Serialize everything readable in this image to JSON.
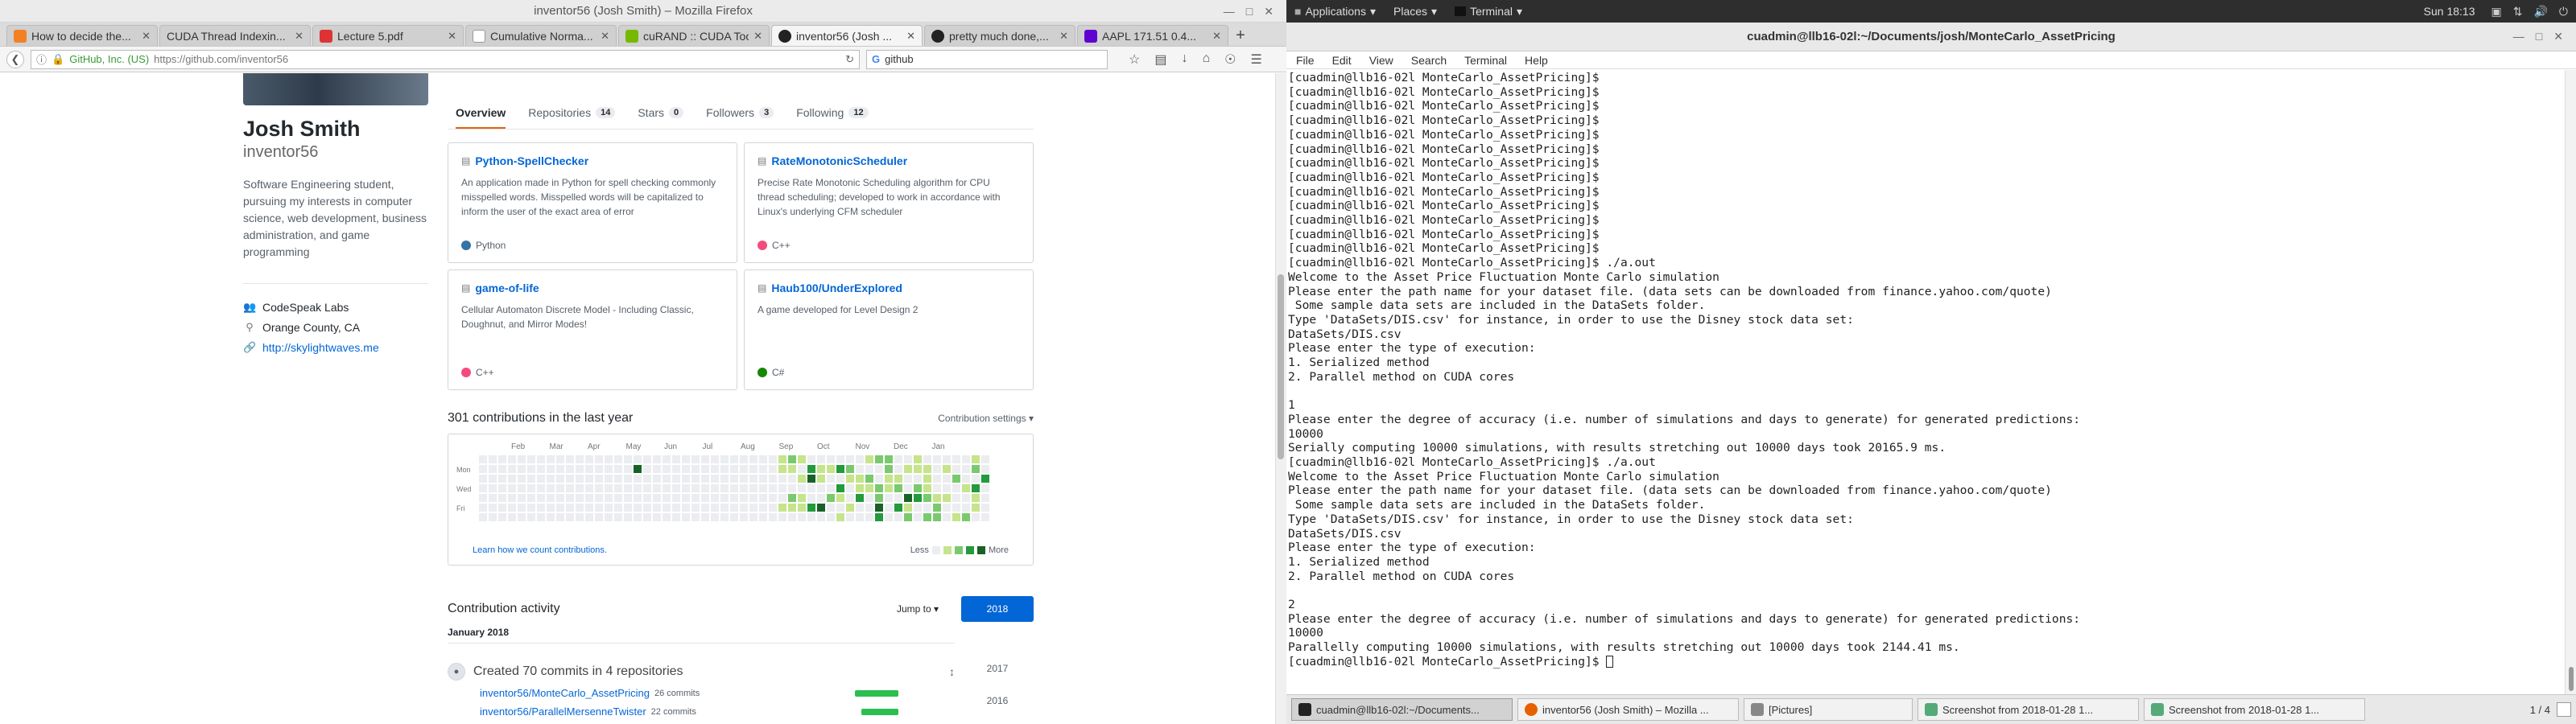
{
  "firefox": {
    "window_title": "inventor56 (Josh Smith) – Mozilla Firefox",
    "tabs": [
      {
        "label": "How to decide the..."
      },
      {
        "label": "CUDA Thread Indexin..."
      },
      {
        "label": "Lecture 5.pdf"
      },
      {
        "label": "Cumulative Norma..."
      },
      {
        "label": "cuRAND :: CUDA Tool..."
      },
      {
        "label": "inventor56 (Josh ..."
      },
      {
        "label": "pretty much done,..."
      },
      {
        "label": "AAPL 171.51 0.4..."
      }
    ],
    "new_tab": "+",
    "site_identity": "GitHub, Inc. (US)",
    "url": "https://github.com/inventor56",
    "search_text": "github"
  },
  "profile": {
    "full_name": "Josh Smith",
    "username": "inventor56",
    "bio": "Software Engineering student, pursuing my interests in computer science, web development, business administration, and game programming",
    "org": "CodeSpeak Labs",
    "location": "Orange County, CA",
    "website": "http://skylightwaves.me"
  },
  "profile_tabs": [
    {
      "label": "Overview",
      "count": ""
    },
    {
      "label": "Repositories",
      "count": "14"
    },
    {
      "label": "Stars",
      "count": "0"
    },
    {
      "label": "Followers",
      "count": "3"
    },
    {
      "label": "Following",
      "count": "12"
    }
  ],
  "pinned": [
    {
      "title": "Python-SpellChecker",
      "desc": "An application made in Python for spell checking commonly misspelled words. Misspelled words will be capitalized to inform the user of the exact area of error",
      "lang": "Python",
      "color": "#3572A5"
    },
    {
      "title": "RateMonotonicScheduler",
      "desc": "Precise Rate Monotonic Scheduling algorithm for CPU thread scheduling; developed to work in accordance with Linux's underlying CFM scheduler",
      "lang": "C++",
      "color": "#f34b7d"
    },
    {
      "title": "game-of-life",
      "desc": "Cellular Automaton Discrete Model - Including Classic, Doughnut, and Mirror Modes!",
      "lang": "C++",
      "color": "#f34b7d"
    },
    {
      "title": "Haub100/UnderExplored",
      "desc": "A game developed for Level Design 2",
      "lang": "C#",
      "color": "#178600"
    }
  ],
  "contributions": {
    "title": "301 contributions in the last year",
    "settings": "Contribution settings ▾",
    "months": [
      "Feb",
      "Mar",
      "Apr",
      "May",
      "Jun",
      "Jul",
      "Aug",
      "Sep",
      "Oct",
      "Nov",
      "Dec",
      "Jan"
    ],
    "days": [
      "Mon",
      "Wed",
      "Fri"
    ],
    "learn_link": "Learn how we count contributions.",
    "less": "Less",
    "more": "More",
    "legend_colors": [
      "#ebedf0",
      "#c6e48b",
      "#7bc96f",
      "#239a3b",
      "#196127"
    ]
  },
  "activity": {
    "title": "Contribution activity",
    "jump_to": "Jump to ▾",
    "years": [
      "2018",
      "2017",
      "2016"
    ],
    "month": "January 2018",
    "commit_summary": "Created 70 commits in 4 repositories",
    "repos": [
      {
        "name": "inventor56/MonteCarlo_AssetPricing",
        "commits": "26 commits"
      },
      {
        "name": "inventor56/ParallelMersenneTwister",
        "commits": "22 commits"
      }
    ]
  },
  "gnome": {
    "applications": "Applications",
    "places": "Places",
    "terminal": "Terminal",
    "clock": "Sun 18:13"
  },
  "terminal": {
    "title": "cuadmin@llb16-02l:~/Documents/josh/MonteCarlo_AssetPricing",
    "menu": [
      "File",
      "Edit",
      "View",
      "Search",
      "Terminal",
      "Help"
    ],
    "lines": [
      "[cuadmin@llb16-02l MonteCarlo_AssetPricing]$",
      "[cuadmin@llb16-02l MonteCarlo_AssetPricing]$",
      "[cuadmin@llb16-02l MonteCarlo_AssetPricing]$",
      "[cuadmin@llb16-02l MonteCarlo_AssetPricing]$",
      "[cuadmin@llb16-02l MonteCarlo_AssetPricing]$",
      "[cuadmin@llb16-02l MonteCarlo_AssetPricing]$",
      "[cuadmin@llb16-02l MonteCarlo_AssetPricing]$",
      "[cuadmin@llb16-02l MonteCarlo_AssetPricing]$",
      "[cuadmin@llb16-02l MonteCarlo_AssetPricing]$",
      "[cuadmin@llb16-02l MonteCarlo_AssetPricing]$",
      "[cuadmin@llb16-02l MonteCarlo_AssetPricing]$",
      "[cuadmin@llb16-02l MonteCarlo_AssetPricing]$",
      "[cuadmin@llb16-02l MonteCarlo_AssetPricing]$",
      "[cuadmin@llb16-02l MonteCarlo_AssetPricing]$ ./a.out",
      "Welcome to the Asset Price Fluctuation Monte Carlo simulation",
      "Please enter the path name for your dataset file. (data sets can be downloaded from finance.yahoo.com/quote)",
      " Some sample data sets are included in the DataSets folder.",
      "Type 'DataSets/DIS.csv' for instance, in order to use the Disney stock data set:",
      "DataSets/DIS.csv",
      "Please enter the type of execution:",
      "1. Serialized method",
      "2. Parallel method on CUDA cores",
      "",
      "1",
      "Please enter the degree of accuracy (i.e. number of simulations and days to generate) for generated predictions:",
      "10000",
      "Serially computing 10000 simulations, with results stretching out 10000 days took 20165.9 ms.",
      "[cuadmin@llb16-02l MonteCarlo_AssetPricing]$ ./a.out",
      "Welcome to the Asset Price Fluctuation Monte Carlo simulation",
      "Please enter the path name for your dataset file. (data sets can be downloaded from finance.yahoo.com/quote)",
      " Some sample data sets are included in the DataSets folder.",
      "Type 'DataSets/DIS.csv' for instance, in order to use the Disney stock data set:",
      "DataSets/DIS.csv",
      "Please enter the type of execution:",
      "1. Serialized method",
      "2. Parallel method on CUDA cores",
      "",
      "2",
      "Please enter the degree of accuracy (i.e. number of simulations and days to generate) for generated predictions:",
      "10000",
      "Parallelly computing 10000 simulations, with results stretching out 10000 days took 2144.41 ms."
    ],
    "prompt": "[cuadmin@llb16-02l MonteCarlo_AssetPricing]$ "
  },
  "taskbar": {
    "tasks": [
      {
        "label": "cuadmin@llb16-02l:~/Documents..."
      },
      {
        "label": "inventor56 (Josh Smith) – Mozilla ..."
      },
      {
        "label": "[Pictures]"
      },
      {
        "label": "Screenshot from 2018-01-28 1..."
      },
      {
        "label": "Screenshot from 2018-01-28 1..."
      }
    ],
    "pager": "1 / 4"
  }
}
